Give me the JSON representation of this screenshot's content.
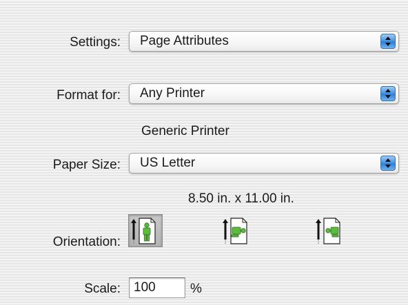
{
  "settings": {
    "label": "Settings:",
    "value": "Page Attributes"
  },
  "format_for": {
    "label": "Format for:",
    "value": "Any Printer",
    "description": "Generic Printer"
  },
  "paper_size": {
    "label": "Paper Size:",
    "value": "US Letter",
    "dimensions": "8.50 in. x 11.00 in."
  },
  "orientation": {
    "label": "Orientation:",
    "options": [
      {
        "icon": "portrait-orientation-icon",
        "selected": true
      },
      {
        "icon": "landscape-orientation-icon",
        "selected": false
      },
      {
        "icon": "reverse-landscape-orientation-icon",
        "selected": false
      }
    ]
  },
  "scale": {
    "label": "Scale:",
    "value": "100",
    "unit": "%"
  },
  "colors": {
    "popup_arrow_blue": "#4d97e3",
    "figure_green": "#5dbb3f"
  }
}
